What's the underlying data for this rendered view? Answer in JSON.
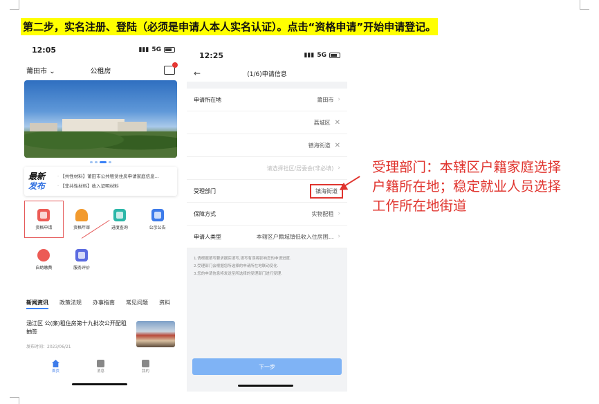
{
  "instruction": "第二步，实名注册、登陆（必须是申请人本人实名认证）。点击“资格申请”开始申请登记。",
  "phone1": {
    "status_time": "12:05",
    "status_net": "5G",
    "city": "莆田市",
    "title": "公租房",
    "news_logo_line1": "最新",
    "news_logo_line2": "发布",
    "news_items": [
      "【共性材料】莆田市公共租赁住房申请家庭信息...",
      "【非共性材料】收入证明材料"
    ],
    "grid": [
      {
        "label": "资格申请",
        "color": "red",
        "icon": "form-icon"
      },
      {
        "label": "资格年审",
        "color": "orange",
        "icon": "user-icon"
      },
      {
        "label": "进度查询",
        "color": "teal",
        "icon": "search-doc-icon"
      },
      {
        "label": "公示公告",
        "color": "blue",
        "icon": "announcement-icon"
      },
      {
        "label": "自助缴费",
        "color": "red",
        "icon": "yuan-icon"
      },
      {
        "label": "服务评价",
        "color": "purple",
        "icon": "rating-icon"
      }
    ],
    "tabs": [
      "新闻资讯",
      "政策法规",
      "办事指南",
      "常见问题",
      "资料"
    ],
    "article_title": "涵江区 公(廉)租住房第十九批次公开配租抽签",
    "article_date": "发布时间：2023/06/21",
    "nav": [
      "首页",
      "消息",
      "我的"
    ]
  },
  "phone2": {
    "status_time": "12:25",
    "status_net": "5G",
    "title": "(1/6)申请信息",
    "rows": {
      "location_label": "申请所在地",
      "location_value": "莆田市",
      "district": "荔城区",
      "street": "镇海街道",
      "community_placeholder": "请选择社区/居委会(非必填)",
      "dept_label": "受理部门",
      "dept_value": "镇海街道",
      "guarantee_label": "保障方式",
      "guarantee_value": "实物配租",
      "type_label": "申请人类型",
      "type_value": "本辖区户籍城镇低收入住房困..."
    },
    "notes": [
      "1.请根据填写要求据实填写,填写有误将影响您的申请进度.",
      "2.受理部门会根据您所选择的申请所在地联动变化.",
      "3.您的申请信息将发送至所选择的受理部门进行受理."
    ],
    "next_button": "下一步"
  },
  "annotation": "受理部门：本辖区户籍家庭选择户籍所在地；稳定就业人员选择工作所在地街道",
  "colors": {
    "highlight": "#ffff00",
    "annotation_red": "#e0342e",
    "primary_blue": "#3d7bea"
  }
}
